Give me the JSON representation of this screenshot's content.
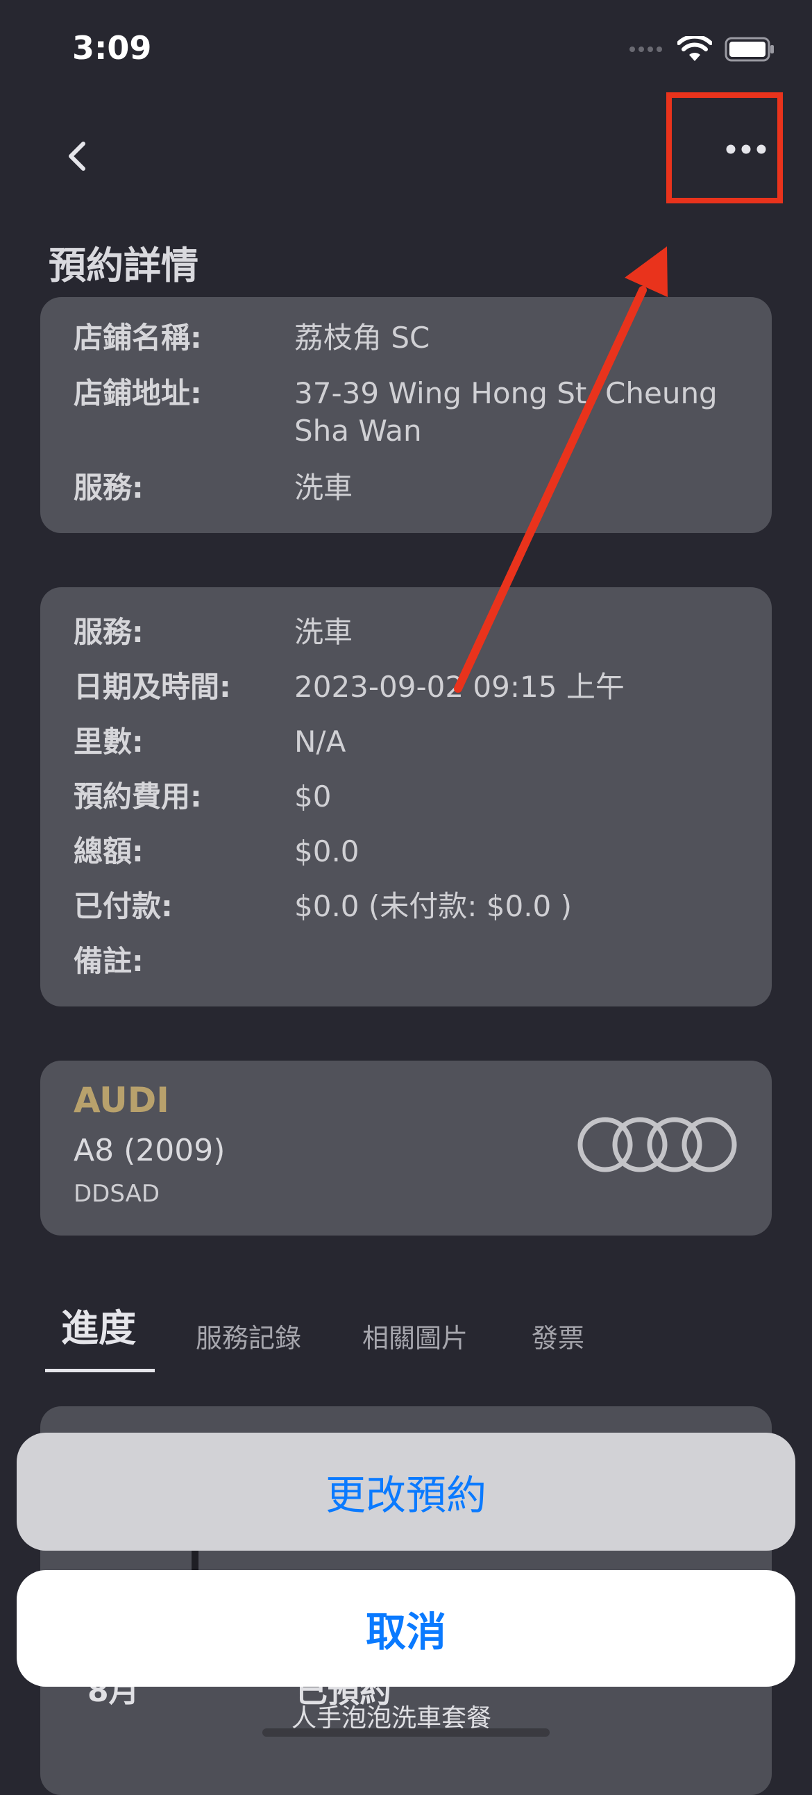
{
  "status_bar": {
    "time": "3:09"
  },
  "page": {
    "title": "預約詳情"
  },
  "store_card": {
    "rows": [
      {
        "label": "店鋪名稱:",
        "value": "荔枝角 SC"
      },
      {
        "label": "店鋪地址:",
        "value": "37-39 Wing Hong St, Cheung Sha Wan"
      },
      {
        "label": "服務:",
        "value": "洗車"
      }
    ]
  },
  "booking_card": {
    "rows": [
      {
        "label": "服務:",
        "value": "洗車"
      },
      {
        "label": "日期及時間:",
        "value": "2023-09-02 09:15 上午"
      },
      {
        "label": "里數:",
        "value": "N/A"
      },
      {
        "label": "預約費用:",
        "value": "$0"
      },
      {
        "label": "總額:",
        "value": "$0.0"
      },
      {
        "label": "已付款:",
        "value": "$0.0 (未付款: $0.0 )"
      },
      {
        "label": "備註:",
        "value": ""
      }
    ]
  },
  "vehicle": {
    "brand": "AUDI",
    "model": "A8 (2009)",
    "plate": "DDSAD",
    "logo_icon": "audi-rings-icon"
  },
  "tabs": [
    {
      "label": "進度",
      "active": true
    },
    {
      "label": "服務記錄",
      "active": false
    },
    {
      "label": "相關圖片",
      "active": false
    },
    {
      "label": "發票",
      "active": false
    }
  ],
  "progress": {
    "month": "8月",
    "item_title": "已預約",
    "item_subtitle": "人手泡泡洗車套餐"
  },
  "action_sheet": {
    "change_label": "更改預約",
    "cancel_label": "取消"
  },
  "colors": {
    "background": "#272730",
    "card": "#51525a",
    "brand_gold": "#b8a16c",
    "ios_blue": "#0a7aff",
    "annotation_red": "#e9331c"
  },
  "icons": {
    "back": "chevron-left-icon",
    "more": "ellipsis-icon",
    "wifi": "wifi-icon",
    "battery": "battery-icon",
    "signal": "signal-icon"
  }
}
